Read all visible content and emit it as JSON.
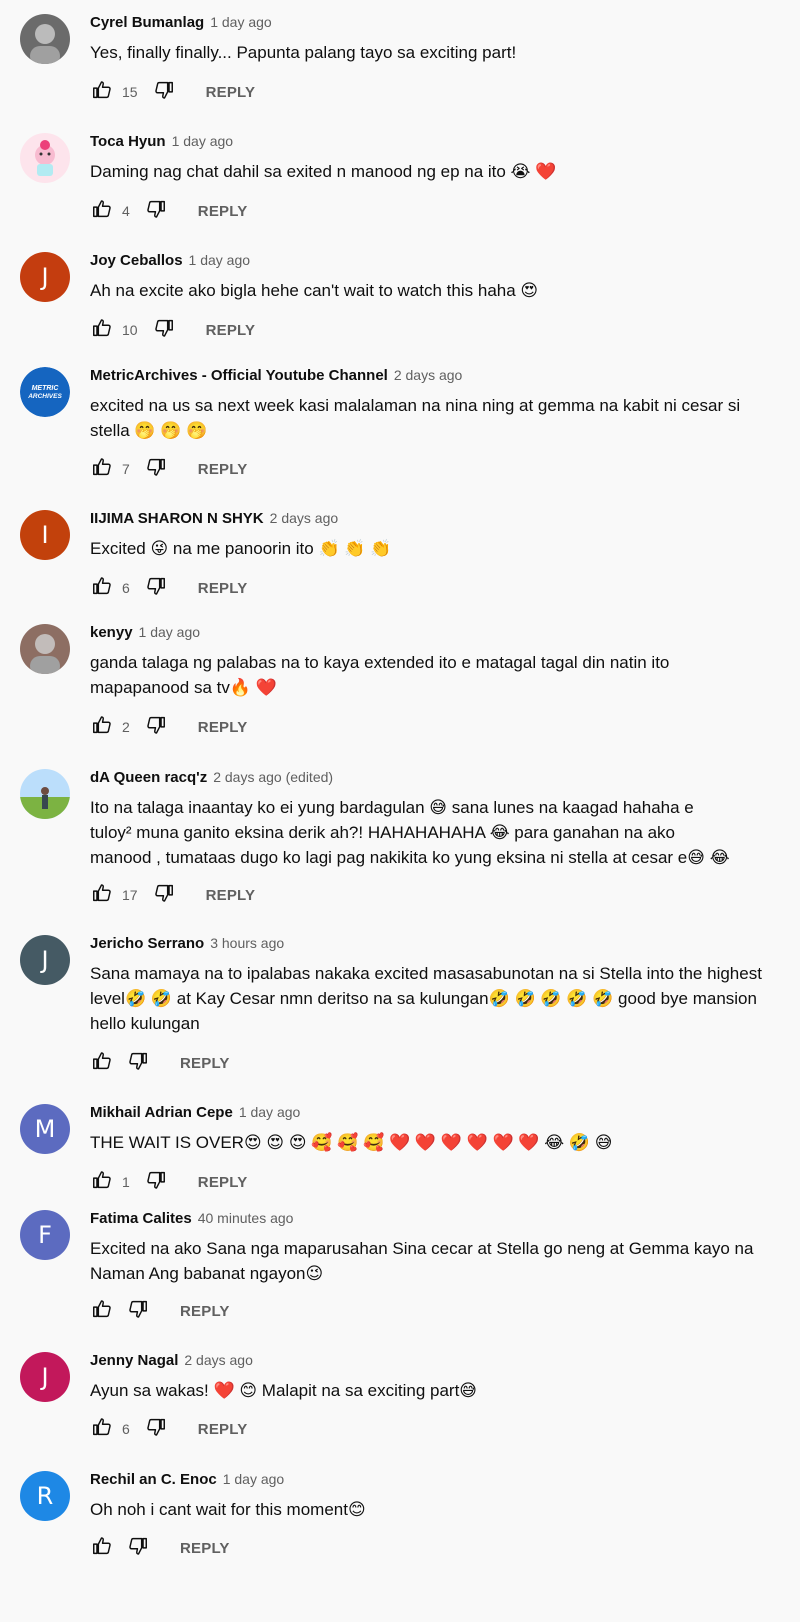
{
  "comments": [
    {
      "author": "Cyrel Bumanlag",
      "time": "1 day ago",
      "text": "Yes, finally finally... Papunta palang tayo sa exciting part!",
      "likes": "15",
      "reply": "REPLY",
      "avatar": {
        "type": "photo",
        "color": "#6b6b6b"
      }
    },
    {
      "author": "Toca Hyun",
      "time": "1 day ago",
      "text": "Daming nag chat dahil sa exited n manood ng ep na ito 😭 ❤️",
      "likes": "4",
      "reply": "REPLY",
      "avatar": {
        "type": "cartoon",
        "color": "#f3c6d3"
      }
    },
    {
      "author": "Joy Ceballos",
      "time": "1 day ago",
      "text": "Ah na excite ako bigla hehe can't wait to watch this haha 😍",
      "likes": "10",
      "reply": "REPLY",
      "avatar": {
        "type": "letter",
        "letter": "J",
        "color": "#c43d0f"
      }
    },
    {
      "author": "MetricArchives - Official Youtube Channel",
      "time": "2 days ago",
      "text": "excited na us sa next week kasi malalaman na nina ning at gemma na kabit ni cesar si stella 🤭 🤭 🤭",
      "likes": "7",
      "reply": "REPLY",
      "avatar": {
        "type": "logo",
        "label": "METRIC ARCHIVES",
        "color": "#1565c0"
      }
    },
    {
      "author": "IIJIMA SHARON N SHYK",
      "time": "2 days ago",
      "text": "Excited 😜  na me panoorin ito  👏 👏 👏",
      "likes": "6",
      "reply": "REPLY",
      "avatar": {
        "type": "letter",
        "letter": "I",
        "color": "#c2410c"
      }
    },
    {
      "author": "kenyy",
      "time": "1 day ago",
      "text": "ganda talaga ng palabas na to kaya extended ito e matagal tagal din natin ito mapapanood sa tv🔥 ❤️",
      "likes": "2",
      "reply": "REPLY",
      "avatar": {
        "type": "photo",
        "color": "#8d6e63"
      }
    },
    {
      "author": "dA Queen racq'z",
      "time": "2 days ago (edited)",
      "text": "Ito na talaga inaantay ko ei yung bardagulan 😅  sana lunes na kaagad hahaha e tuloy² muna ganito eksina derik ah?!  HAHAHAHAHA 😂  para ganahan na ako manood , tumataas dugo ko lagi pag nakikita ko yung eksina ni stella at cesar e😅 😂",
      "likes": "17",
      "reply": "REPLY",
      "avatar": {
        "type": "landscape",
        "color": "#7cb342"
      }
    },
    {
      "author": "Jericho Serrano",
      "time": "3 hours ago",
      "text": "Sana mamaya na to ipalabas nakaka excited masasabunotan na si Stella into the highest level🤣 🤣 at Kay Cesar nmn deritso na sa  kulungan🤣 🤣 🤣 🤣 🤣  good bye mansion hello kulungan",
      "likes": "",
      "reply": "REPLY",
      "avatar": {
        "type": "letter",
        "letter": "J",
        "color": "#455a64"
      }
    },
    {
      "author": "Mikhail Adrian Cepe",
      "time": "1 day ago",
      "text": "THE WAIT IS OVER😍 😍 😍 🥰 🥰 🥰 ❤️ ❤️ ❤️ ❤️ ❤️ ❤️ 😂 🤣 😅",
      "likes": "1",
      "reply": "REPLY",
      "avatar": {
        "type": "letter",
        "letter": "M",
        "color": "#5c6bc0"
      }
    },
    {
      "author": "Fatima Calites",
      "time": "40 minutes ago",
      "text": "Excited na ako Sana nga maparusahan Sina cecar at Stella go neng at Gemma kayo na Naman Ang babanat ngayon😉",
      "likes": "",
      "reply": "REPLY",
      "avatar": {
        "type": "letter",
        "letter": "F",
        "color": "#5c6bc0"
      }
    },
    {
      "author": "Jenny Nagal",
      "time": "2 days ago",
      "text": "Ayun sa wakas! ❤️ 😊  Malapit na sa exciting part😅",
      "likes": "6",
      "reply": "REPLY",
      "avatar": {
        "type": "letter",
        "letter": "J",
        "color": "#c2185b"
      }
    },
    {
      "author": "Rechil an C. Enoc",
      "time": "1 day ago",
      "text": "Oh noh i cant wait for this moment😊",
      "likes": "",
      "reply": "REPLY",
      "avatar": {
        "type": "letter",
        "letter": "R",
        "color": "#1e88e5"
      }
    }
  ]
}
